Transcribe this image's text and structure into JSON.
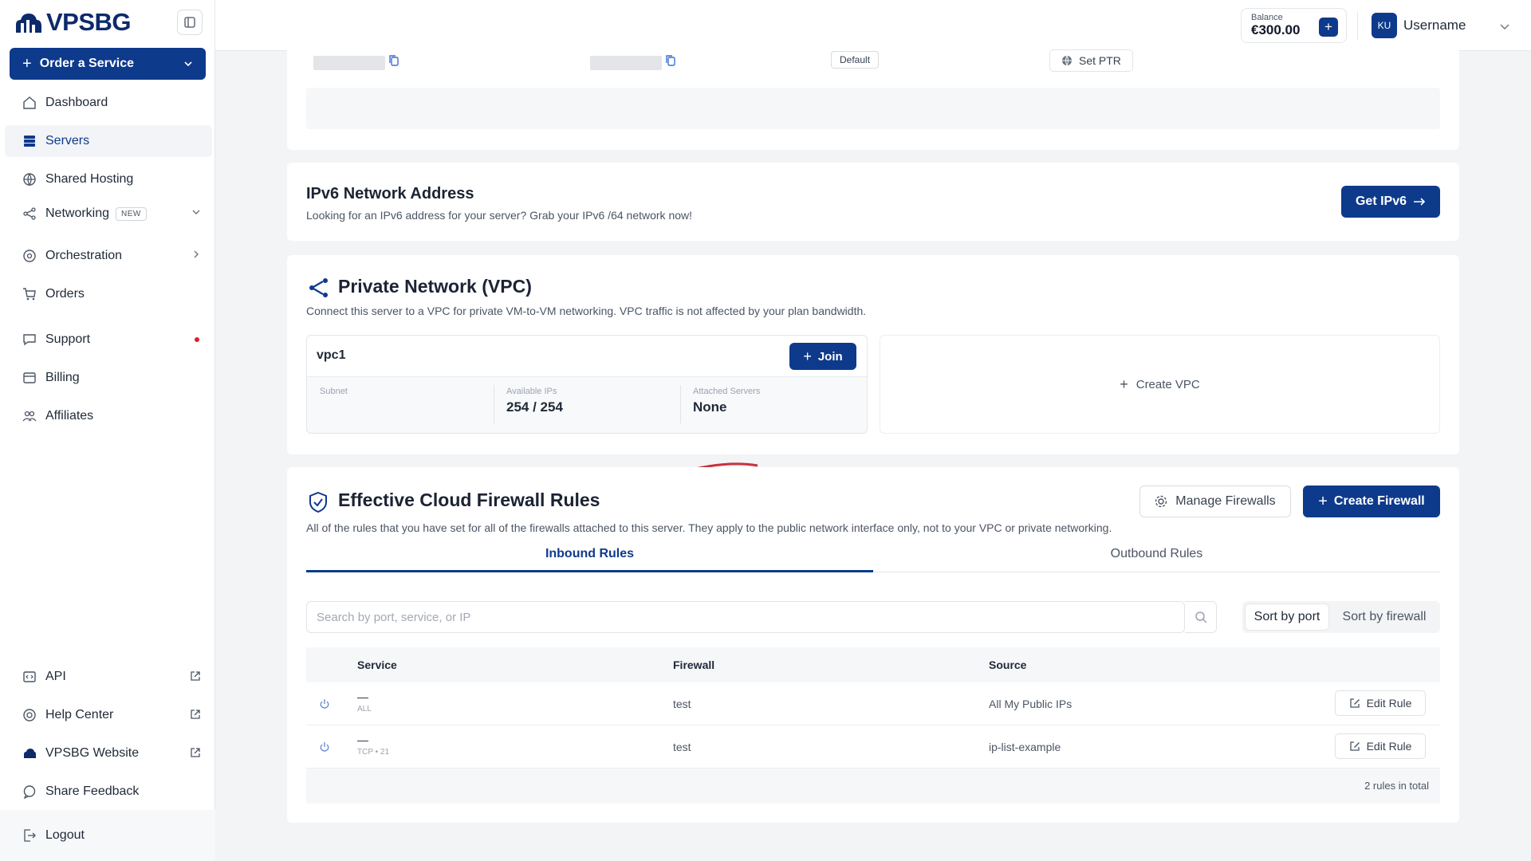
{
  "brand": {
    "name": "VPSBG",
    "accent": "#0e3a8c"
  },
  "sidebar": {
    "order_button": "Order a Service",
    "items": [
      {
        "label": "Dashboard",
        "icon": "home-icon"
      },
      {
        "label": "Servers",
        "icon": "server-icon",
        "active": true
      },
      {
        "label": "Shared Hosting",
        "icon": "globe-icon"
      },
      {
        "label": "Networking",
        "icon": "share-icon",
        "badge": "NEW"
      },
      {
        "label": "Orchestration",
        "icon": "orchestration-icon"
      },
      {
        "label": "Orders",
        "icon": "cart-icon"
      },
      {
        "label": "Support",
        "icon": "chat-icon"
      },
      {
        "label": "Billing",
        "icon": "billing-icon"
      },
      {
        "label": "Affiliates",
        "icon": "users-icon"
      }
    ],
    "bottom_items": [
      {
        "label": "API",
        "icon": "code-icon"
      },
      {
        "label": "Help Center",
        "icon": "lifebuoy-icon"
      },
      {
        "label": "VPSBG Website",
        "icon": "cloud-icon"
      },
      {
        "label": "Share Feedback",
        "icon": "message-icon"
      }
    ],
    "logout": "Logout"
  },
  "header": {
    "balance_label": "Balance",
    "balance_amount": "€300.00",
    "avatar_initials": "KU",
    "username": "Username"
  },
  "ip_section": {
    "default_tag": "Default",
    "set_ptr": "Set PTR"
  },
  "ipv6": {
    "title": "IPv6 Network Address",
    "description": "Looking for an IPv6 address for your server? Grab your IPv6 /64 network now!",
    "button": "Get IPv6"
  },
  "vpc": {
    "title": "Private Network (VPC)",
    "description": "Connect this server to a VPC for private VM-to-VM networking. VPC traffic is not affected by your plan bandwidth.",
    "card": {
      "name": "vpc1",
      "join_button": "Join",
      "subnet_label": "Subnet",
      "available_label": "Available IPs",
      "available_value": "254 / 254",
      "attached_label": "Attached Servers",
      "attached_value": "None"
    },
    "create_label": "Create VPC"
  },
  "firewall": {
    "title": "Effective Cloud Firewall Rules",
    "description": "All of the rules that you have set for all of the firewalls attached to this server. They apply to the public network interface only, not to your VPC or private networking.",
    "manage_button": "Manage Firewalls",
    "create_button": "Create Firewall",
    "tabs": [
      "Inbound Rules",
      "Outbound Rules"
    ],
    "search_placeholder": "Search by port, service, or IP",
    "sort_port": "Sort by port",
    "sort_firewall": "Sort by firewall",
    "columns": {
      "service": "Service",
      "firewall": "Firewall",
      "source": "Source"
    },
    "rows": [
      {
        "service": "—",
        "protocol": "ALL",
        "firewall": "test",
        "source": "All My Public IPs",
        "action": "Edit Rule"
      },
      {
        "service": "—",
        "protocol": "TCP • 21",
        "firewall": "test",
        "source": "ip-list-example",
        "action": "Edit Rule"
      }
    ],
    "total": "2 rules in total"
  }
}
